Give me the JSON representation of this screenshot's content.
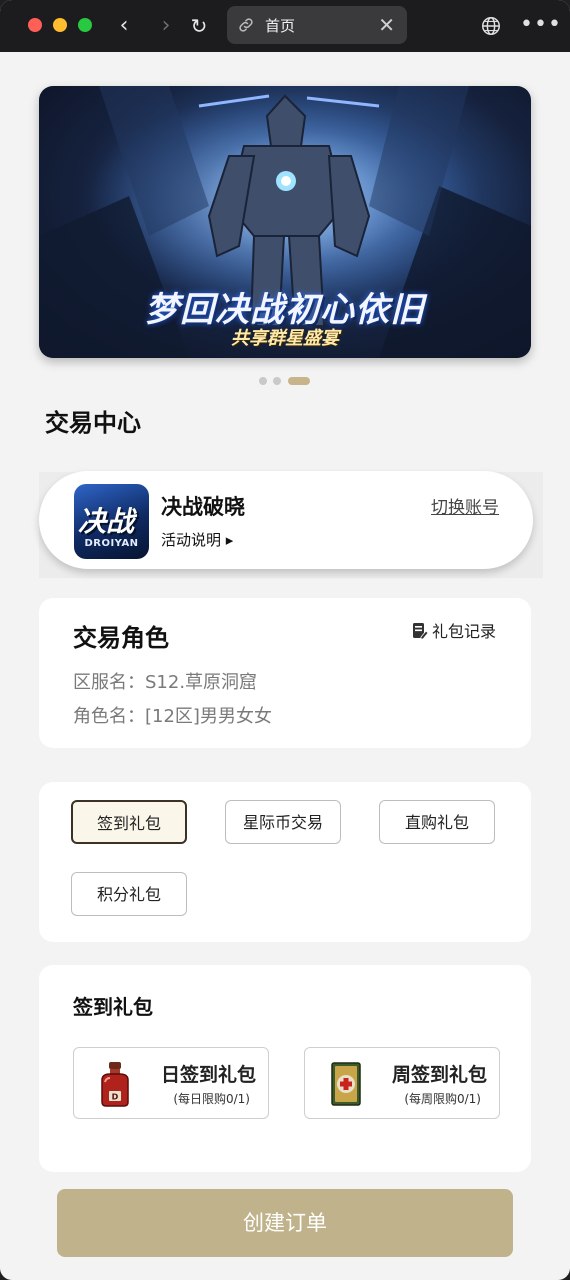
{
  "browser": {
    "tab_title": "首页",
    "tab_close": "✕",
    "more": "•••",
    "back": "‹",
    "forward": "›",
    "reload": "↻"
  },
  "banner": {
    "title": "梦回决战初心依旧",
    "subtitle": "共享群星盛宴",
    "pages": 3,
    "active_page": 3
  },
  "section": {
    "title": "交易中心"
  },
  "game": {
    "logo_text": "决战",
    "logo_subtext": "DROIYAN",
    "name": "决战破晓",
    "desc": "活动说明 ▸",
    "switch_label": "切换账号"
  },
  "role": {
    "title": "交易角色",
    "record_label": "礼包记录",
    "server_line": "区服名：S12.草原洞窟",
    "role_line": "角色名：[12区]男男女女"
  },
  "types": [
    "签到礼包",
    "星际币交易",
    "直购礼包",
    "积分礼包"
  ],
  "selected_type": "签到礼包",
  "packs": {
    "title": "签到礼包",
    "items": [
      {
        "name": "日签到礼包",
        "limit": "(每日限购0/1)",
        "icon": "potion-icon"
      },
      {
        "name": "周签到礼包",
        "limit": "(每周限购0/1)",
        "icon": "card-icon"
      }
    ]
  },
  "create_button": "创建订单",
  "colors": {
    "accent": "#c0b28a",
    "pager_active": "#c8b48a",
    "active_border": "#3b3225"
  }
}
